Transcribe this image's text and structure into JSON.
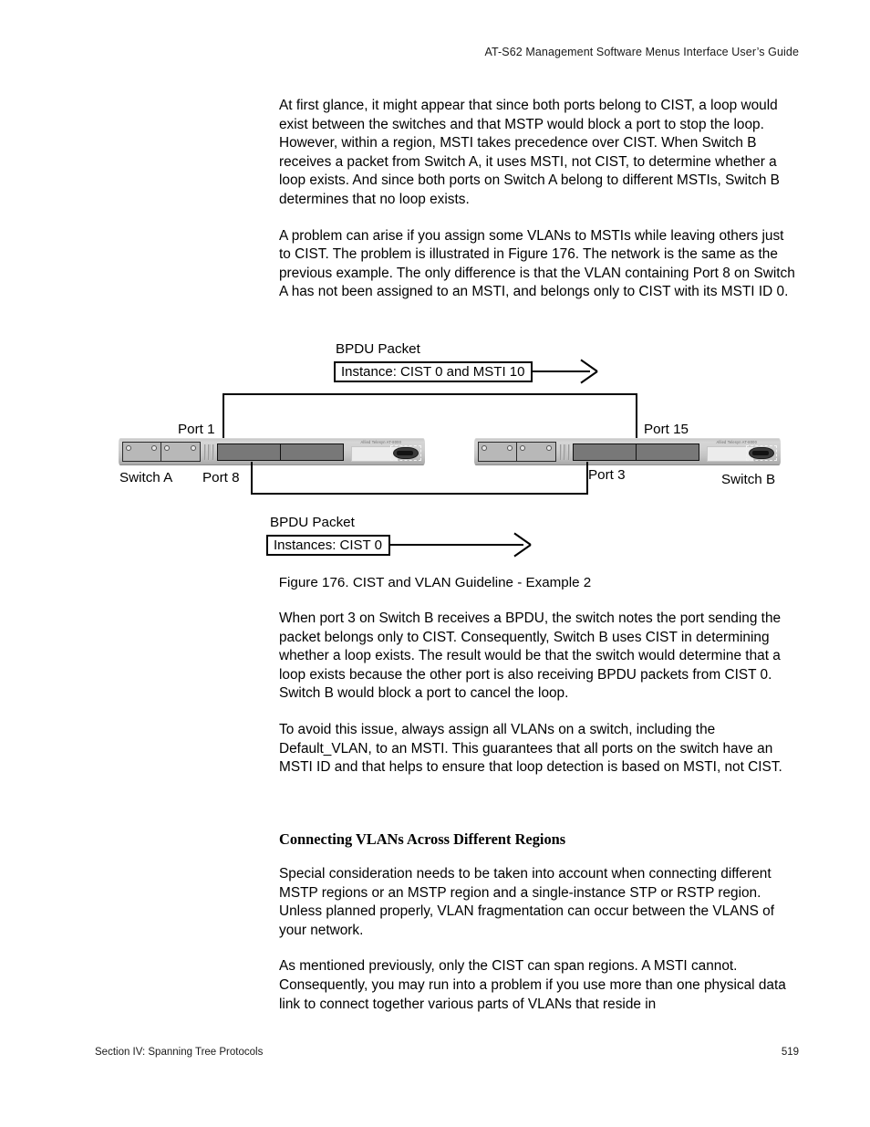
{
  "page": {
    "running_head": "AT-S62 Management Software Menus Interface User’s Guide",
    "footer_left": "Section IV: Spanning Tree Protocols",
    "footer_page_number": "519"
  },
  "body": {
    "paragraph_1": "At first glance, it might appear that since both ports belong to CIST, a loop would exist between the switches and that MSTP would block a port to stop the loop. However, within a region, MSTI takes precedence over CIST. When Switch B receives a packet from Switch A, it uses MSTI, not CIST, to determine whether a loop exists. And since both ports on Switch A belong to different MSTIs, Switch B determines that no loop exists.",
    "paragraph_2": "A problem can arise if you assign some VLANs to MSTIs while leaving others just to CIST. The problem is illustrated in Figure 176. The network is the same as the previous example. The only difference is that the VLAN containing Port 8 on Switch A has not been assigned to an MSTI, and belongs only to CIST with its MSTI ID 0.",
    "paragraph_3": "When port 3 on Switch B receives a BPDU, the switch notes the port sending the packet belongs only to CIST. Consequently, Switch B uses CIST in determining whether a loop exists. The result would be that the switch would determine that a loop exists because the other port is also receiving BPDU packets from CIST 0. Switch B would block a port to cancel the loop.",
    "paragraph_4": "To avoid this issue, always assign all VLANs on a switch, including the Default_VLAN, to an MSTI. This guarantees that all ports on the switch have an MSTI ID and that helps to ensure that loop detection is based on MSTI, not CIST.",
    "heading_1": "Connecting VLANs Across Different Regions",
    "paragraph_5": "Special consideration needs to be taken into account when connecting different MSTP regions or an MSTP region and a single-instance STP or RSTP region. Unless planned properly, VLAN fragmentation can occur between the VLANS of your network.",
    "paragraph_6": "As mentioned previously, only the CIST can span regions. A MSTI cannot. Consequently, you may run into a problem if you use more than one physical data link to connect together various parts of VLANs that reside in"
  },
  "figure": {
    "caption": "Figure 176. CIST and VLAN Guideline - Example 2",
    "top_bpdu_label": "BPDU Packet",
    "top_instance_box": "Instance: CIST 0 and MSTI 10",
    "bottom_bpdu_label": "BPDU Packet",
    "bottom_instance_box": "Instances: CIST 0",
    "switch_a_name": "Switch A",
    "switch_b_name": "Switch B",
    "port_label_1": "Port 1",
    "port_label_8": "Port 8",
    "port_label_15": "Port 15",
    "port_label_3": "Port 3",
    "switch_a_brand": "Allied Telesyn  AT-8000",
    "switch_b_brand": "Allied Telesyn  AT-8000"
  }
}
